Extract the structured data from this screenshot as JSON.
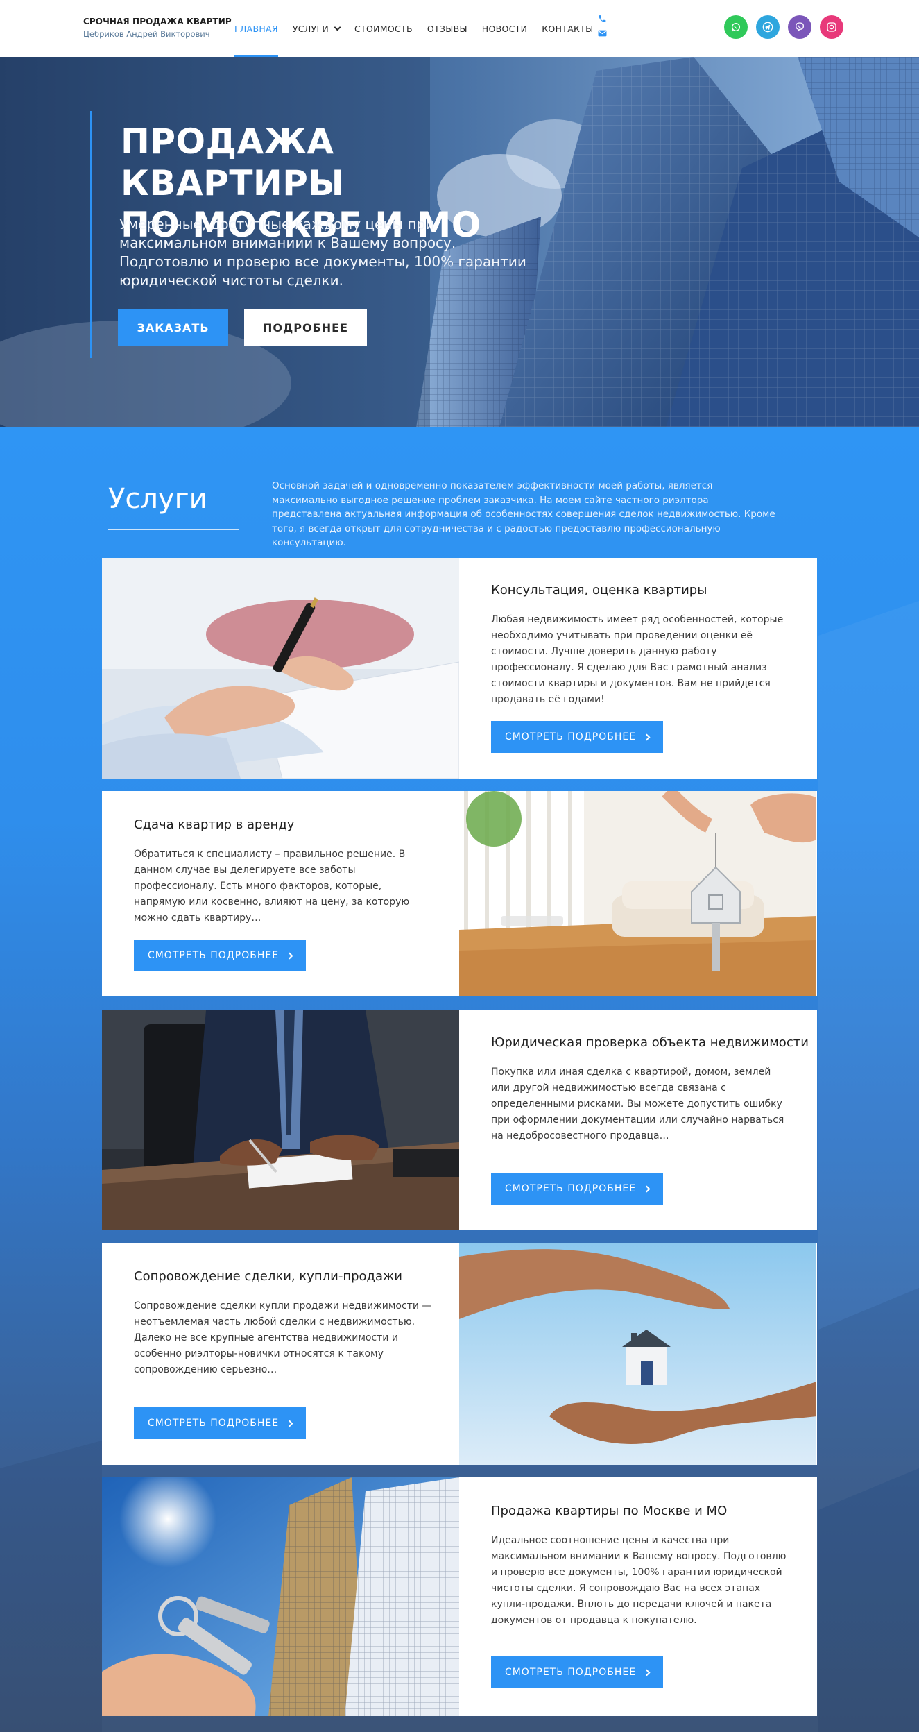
{
  "header": {
    "brand_title": "СРОЧНАЯ ПРОДАЖА КВАРТИР",
    "brand_sub": "Цебриков Андрей Викторович",
    "nav": [
      {
        "label": "ГЛАВНАЯ",
        "active": true
      },
      {
        "label": "УСЛУГИ",
        "dropdown": true
      },
      {
        "label": "СТОИМОСТЬ"
      },
      {
        "label": "ОТЗЫВЫ"
      },
      {
        "label": "НОВОСТИ"
      },
      {
        "label": "КОНТАКТЫ"
      }
    ],
    "contact_icons": [
      "phone-icon",
      "envelope-icon"
    ],
    "socials": [
      "whatsapp-icon",
      "telegram-icon",
      "viber-icon",
      "instagram-icon"
    ],
    "colors": {
      "accent": "#2d93f5",
      "whatsapp": "#30c95a",
      "telegram": "#2ea6de",
      "viber": "#7b56b9",
      "instagram": "#e8397a"
    }
  },
  "hero": {
    "title_line1": "ПРОДАЖА КВАРТИРЫ",
    "title_line2": "ПО МОСКВЕ И МО",
    "text": "Умеренные, доступные каждому цены при максимальном вниманиии к Вашему вопросу. Подготовлю и проверю все документы, 100% гарантии юридической чистоты сделки.",
    "order_label": "ЗАКАЗАТЬ",
    "more_label": "ПОДРОБНЕЕ",
    "prev_arrow": "‹",
    "next_arrow": "›",
    "slides_count": 3,
    "active_slide": 1
  },
  "services": {
    "title": "Услуги",
    "description": "Основной задачей и одновременно показателем эффективности моей работы, является максимально выгодное решение проблем заказчика. На моем сайте частного риэлтора представлена актуальная информация об особенностях совершения сделок недвижимостью. Кроме того, я всегда открыт для сотрудничества и с радостью предоставлю профессиональную консультацию.",
    "button_label": "СМОТРЕТЬ ПОДРОБНЕЕ",
    "cards": [
      {
        "title": "Консультация, оценка квартиры",
        "text": "Любая недвижимость имеет ряд особенностей, которые необходимо учитывать при проведении оценки её стоимости. Лучше доверить данную работу профессионалу. Я сделаю для Вас грамотный анализ стоимости квартиры и документов. Вам не прийдется продавать её годами!",
        "image": "hand-signing-document"
      },
      {
        "title": "Сдача квартир в аренду",
        "text": "Обратиться к специалисту – правильное решение. В данном случае вы делегируете все заботы профессионалу. Есть много факторов, которые, напрямую или косвенно, влияют на цену, за которую можно сдать квартиру…",
        "image": "hand-holding-key-over-living-room"
      },
      {
        "title": "Юридическая проверка объекта недвижимости",
        "text": "Покупка или иная сделка с квартирой, домом, землей или другой недвижимостью всегда связана с определенными рисками. Вы можете допустить ошибку при оформлении документации или случайно нарваться на недобросовестного продавца…",
        "image": "businessman-signing-contract"
      },
      {
        "title": "Сопровождение сделки, купли-продажи",
        "text": "Сопровождение сделки купли продажи недвижимости — неотъемлемая часть любой сделки с недвижимостью. Далеко не все крупные агентства недвижимости и особенно риэлторы-новички относятся к такому сопровождению серьезно…",
        "image": "hands-protecting-house"
      },
      {
        "title": "Продажа квартиры по Москве и МО",
        "text": "Идеальное соотношение цены и качества при максимальном внимании к Вашему вопросу. Подготовлю и проверю все документы, 100% гарантии юридической чистоты сделки. Я сопровождаю Вас на всех этапах купли-продажи. Вплоть до передачи ключей и пакета документов от продавца к покупателю.",
        "image": "keys-in-hand-before-building"
      }
    ]
  }
}
